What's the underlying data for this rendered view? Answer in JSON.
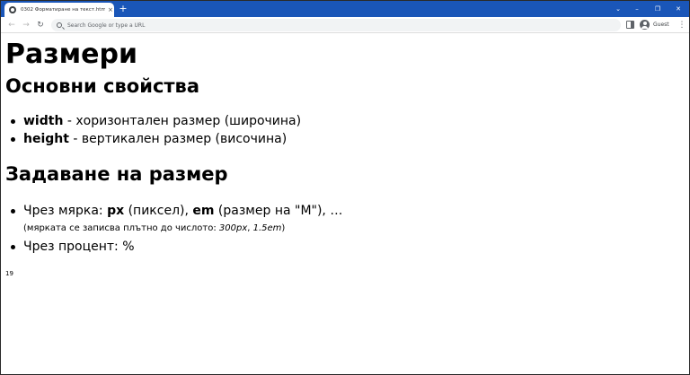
{
  "browser": {
    "tab_title": "0302 Форматиране на текст.htm",
    "tab_close": "×",
    "new_tab": "+",
    "window_controls": {
      "chevron": "⌄",
      "minimize": "–",
      "maximize": "❐",
      "close": "✕"
    },
    "nav": {
      "back": "←",
      "forward": "→",
      "reload": "↻"
    },
    "address_placeholder": "Search Google or type a URL",
    "profile_label": "Guest",
    "menu": "⋮",
    "colors": {
      "titlebar": "#1a56b8"
    },
    "icons": [
      "globe-icon",
      "close-icon",
      "plus-icon",
      "chevron-down-icon",
      "minimize-icon",
      "maximize-icon",
      "close-window-icon",
      "back-arrow-icon",
      "forward-arrow-icon",
      "reload-icon",
      "search-icon",
      "side-panel-icon",
      "avatar-icon",
      "kebab-menu-icon"
    ]
  },
  "page": {
    "title": "Размери",
    "section1": {
      "heading": "Основни свойства",
      "items": [
        {
          "term": "width",
          "text": " - хоризонтален размер (широчина)"
        },
        {
          "term": "height",
          "text": " - вертикален размер (височина)"
        }
      ]
    },
    "section2": {
      "heading": "Задаване на размер",
      "item1": {
        "prefix": "Чрез мярка: ",
        "px": "px",
        "px_desc": " (пиксел), ",
        "em": "em",
        "em_desc": " (размер на \"M\"), …"
      },
      "note": {
        "text": "(мярката се записва плътно до числото: ",
        "ex1": "300px",
        "sep": ", ",
        "ex2": "1.5em",
        "end": ")"
      },
      "item2": "Чрез процент: %"
    },
    "page_number": "19"
  }
}
